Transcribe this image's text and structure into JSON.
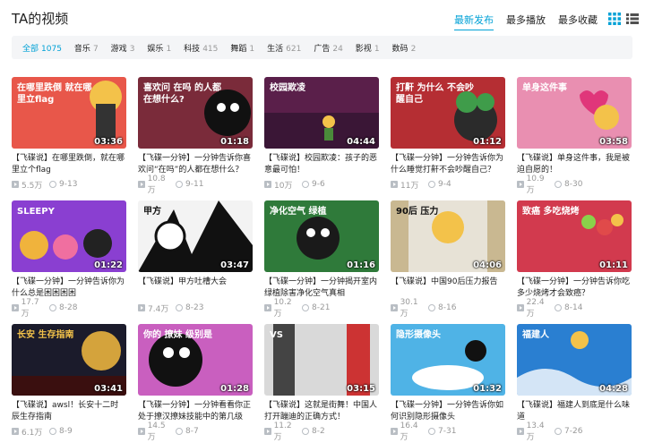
{
  "header": {
    "title": "TA的视频",
    "sort_tabs": [
      "最新发布",
      "最多播放",
      "最多收藏"
    ],
    "active_sort": 0
  },
  "filters": [
    {
      "label": "全部",
      "count": "1075",
      "active": true
    },
    {
      "label": "音乐",
      "count": "7"
    },
    {
      "label": "游戏",
      "count": "3"
    },
    {
      "label": "娱乐",
      "count": "1"
    },
    {
      "label": "科技",
      "count": "415"
    },
    {
      "label": "舞蹈",
      "count": "1"
    },
    {
      "label": "生活",
      "count": "621"
    },
    {
      "label": "广告",
      "count": "24"
    },
    {
      "label": "影视",
      "count": "1"
    },
    {
      "label": "数码",
      "count": "2"
    }
  ],
  "videos": [
    {
      "title": "【飞碟说】在哪里跌倒，就在哪里立个flag",
      "duration": "03:36",
      "plays": "5.5万",
      "date": "9-13",
      "thumb_text": "在哪里跌倒 就在哪里立flag",
      "bg": "#e8574a"
    },
    {
      "title": "【飞碟一分钟】一分钟告诉你喜欢问“在吗”的人都在想什么？",
      "duration": "01:18",
      "plays": "10.8万",
      "date": "9-11",
      "thumb_text": "喜欢问 在吗 的人都在想什么?",
      "bg": "#7a2b3a"
    },
    {
      "title": "【飞碟说】校园欺凌：孩子的恶意最可怕！",
      "duration": "04:44",
      "plays": "10万",
      "date": "9-6",
      "thumb_text": "校园欺凌",
      "bg": "#5a1f4a"
    },
    {
      "title": "【飞碟一分钟】一分钟告诉你为什么睡觉打鼾不会吵醒自己？",
      "duration": "01:12",
      "plays": "11万",
      "date": "9-4",
      "thumb_text": "打鼾 为什么 不会吵醒自己",
      "bg": "#b52e33"
    },
    {
      "title": "【飞碟说】单身这件事，我是被迫自愿的！",
      "duration": "03:58",
      "plays": "10.9万",
      "date": "8-30",
      "thumb_text": "单身这件事",
      "bg": "#e98fb1"
    },
    {
      "title": "【飞碟一分钟】一分钟告诉你为什么总是困困困困",
      "duration": "01:22",
      "plays": "17.7万",
      "date": "8-28",
      "thumb_text": "SLEEPY",
      "bg": "#8a3fd1"
    },
    {
      "title": "【飞碟说】甲方吐槽大会",
      "duration": "03:47",
      "plays": "7.4万",
      "date": "8-23",
      "thumb_text": "甲方",
      "bg": "#f3f3f3"
    },
    {
      "title": "【飞碟一分钟】一分钟揭开室内绿植除害净化空气真相",
      "duration": "01:16",
      "plays": "10.2万",
      "date": "8-21",
      "thumb_text": "净化空气 绿植",
      "bg": "#2f7a3a"
    },
    {
      "title": "【飞碟说】中国90后压力报告",
      "duration": "04:06",
      "plays": "30.1万",
      "date": "8-16",
      "thumb_text": "90后 压力",
      "bg": "#e7e2d6"
    },
    {
      "title": "【飞碟一分钟】一分钟告诉你吃多少烧烤才会致癌？",
      "duration": "01:11",
      "plays": "22.4万",
      "date": "8-14",
      "thumb_text": "致癌 多吃烧烤",
      "bg": "#d23a4e"
    },
    {
      "title": "【飞碟说】awsl！长安十二时辰生存指南",
      "duration": "03:41",
      "plays": "6.1万",
      "date": "8-9",
      "thumb_text": "长安 生存指南",
      "bg": "#1b1b2b"
    },
    {
      "title": "【飞碟一分钟】一分钟看看你正处于撩汉撩妹技能中的第几级",
      "duration": "01:28",
      "plays": "14.5万",
      "date": "8-7",
      "thumb_text": "你的 撩妹 级别是",
      "bg": "#c95fbf"
    },
    {
      "title": "【飞碟说】这就是街舞！中国人打开蹦迪的正确方式！",
      "duration": "03:15",
      "plays": "11.2万",
      "date": "8-2",
      "thumb_text": "VS",
      "bg": "#d9d9d9"
    },
    {
      "title": "【飞碟一分钟】一分钟告诉你如何识别隐形摄像头",
      "duration": "01:32",
      "plays": "16.4万",
      "date": "7-31",
      "thumb_text": "隐形摄像头",
      "bg": "#4fb3e6"
    },
    {
      "title": "【飞碟说】福建人到底是什么味道",
      "duration": "04:28",
      "plays": "13.4万",
      "date": "7-26",
      "thumb_text": "福建人",
      "bg": "#2a7fd1"
    }
  ],
  "colors": {
    "accent": "#00a1d6",
    "muted": "#999999"
  },
  "icons": [
    "grid-view-icon",
    "list-view-icon",
    "play-count-icon",
    "date-icon"
  ]
}
